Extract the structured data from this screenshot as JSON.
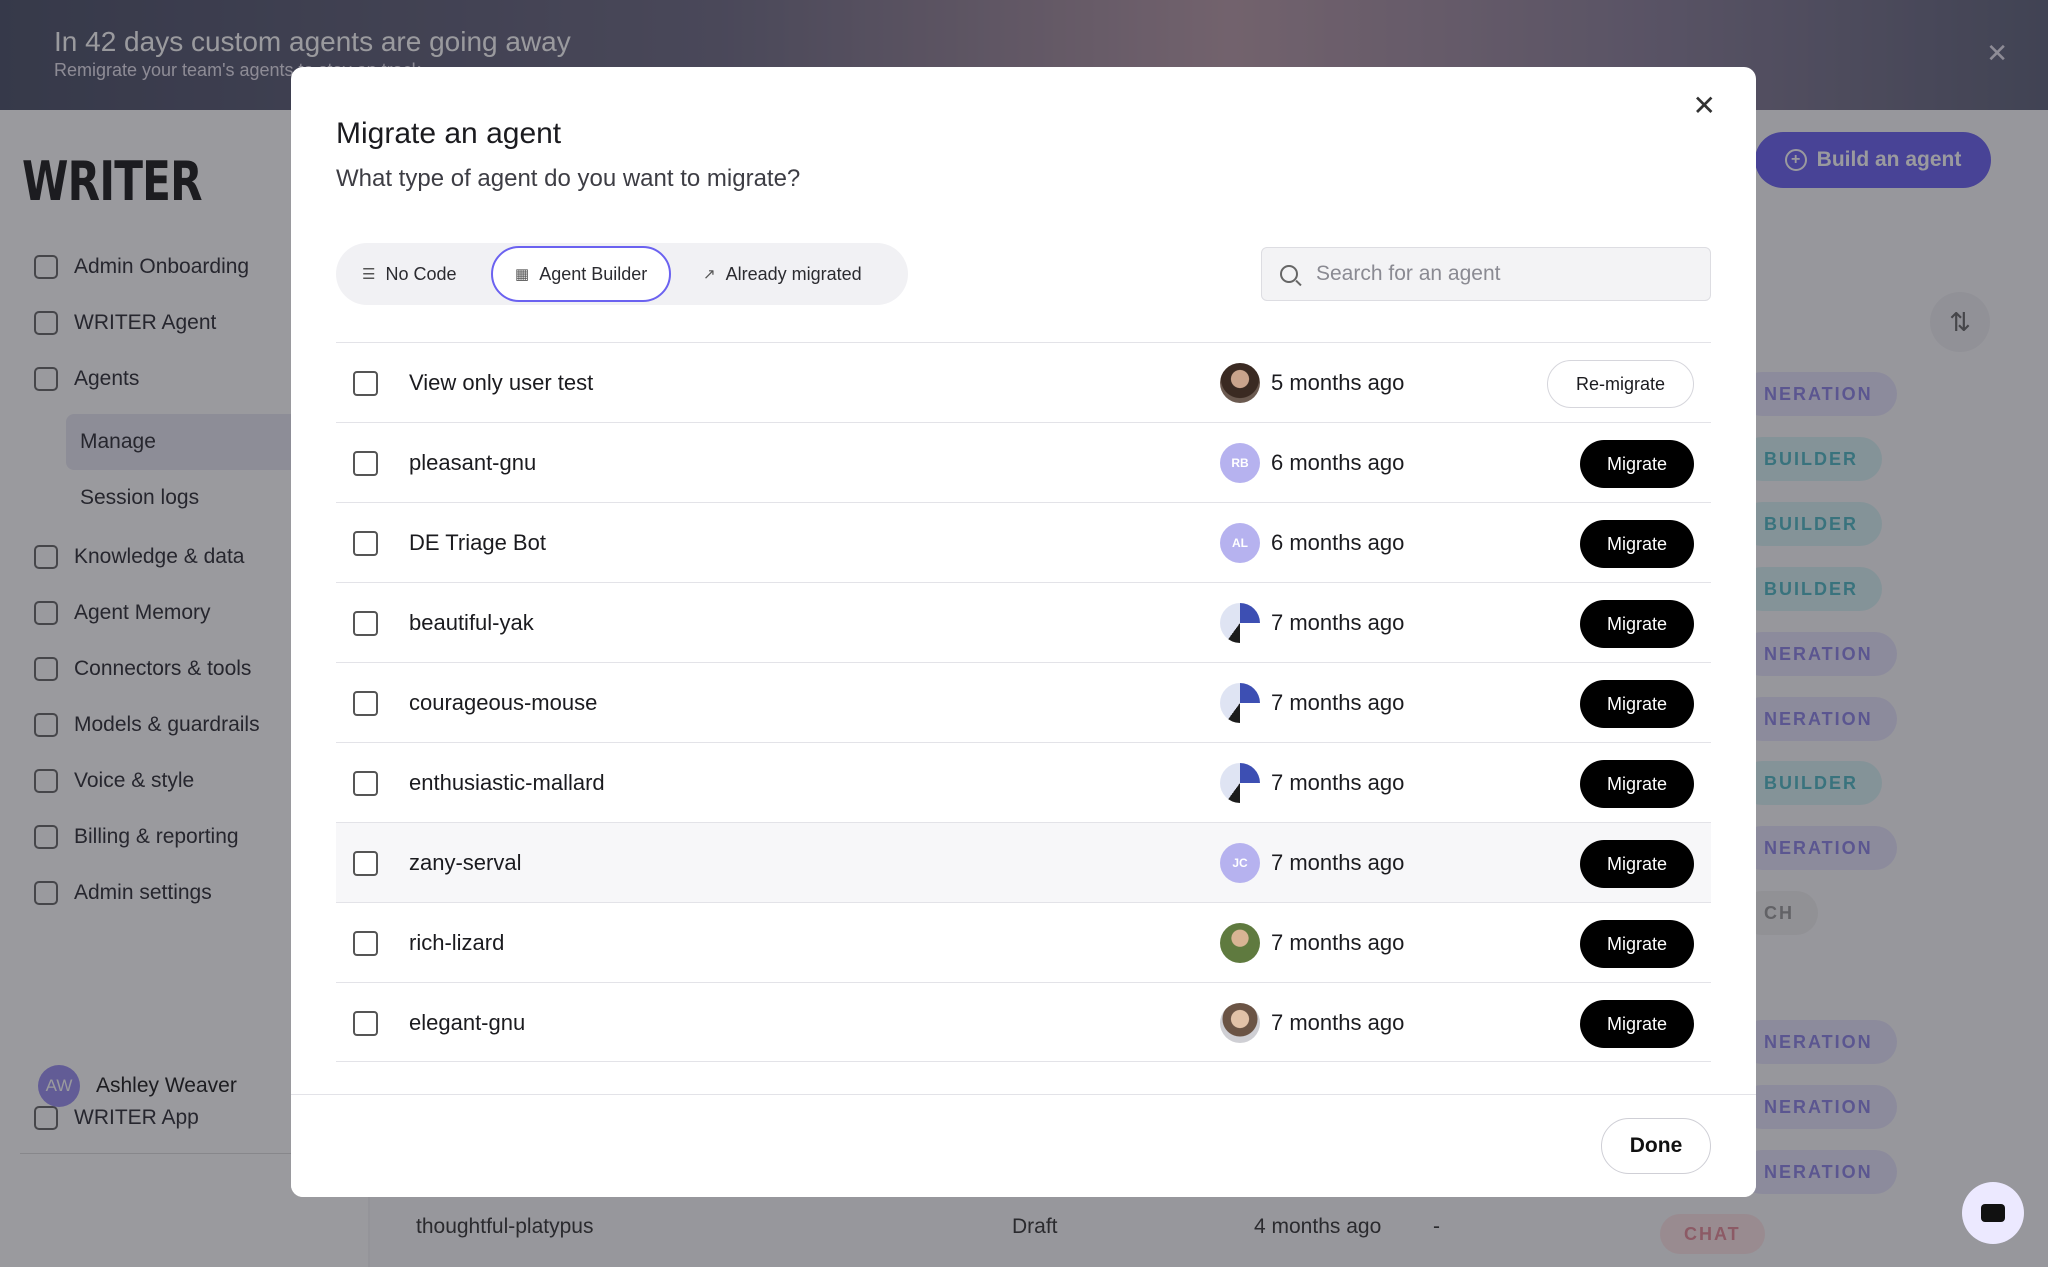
{
  "banner": {
    "title": "In 42 days custom agents are going away",
    "subtitle": "Remigrate your team's agents to stay on track",
    "close": "✕"
  },
  "sidebar": {
    "logo": "WRITER",
    "items": [
      {
        "label": "Admin Onboarding",
        "icon": "clipboard-icon"
      },
      {
        "label": "WRITER Agent",
        "icon": "writer-logo-icon"
      },
      {
        "label": "Agents",
        "icon": "agent-icon"
      },
      {
        "label": "Knowledge & data",
        "icon": "knowledge-icon"
      },
      {
        "label": "Agent Memory",
        "icon": "brain-icon"
      },
      {
        "label": "Connectors & tools",
        "icon": "plug-icon"
      },
      {
        "label": "Models & guardrails",
        "icon": "chip-icon"
      },
      {
        "label": "Voice & style",
        "icon": "palette-icon"
      },
      {
        "label": "Billing & reporting",
        "icon": "chart-icon"
      },
      {
        "label": "Admin settings",
        "icon": "sliders-icon"
      }
    ],
    "subitems": [
      {
        "label": "Manage",
        "active": true
      },
      {
        "label": "Session logs",
        "active": false
      }
    ],
    "writer_app": "WRITER App",
    "user": {
      "initials": "AW",
      "name": "Ashley Weaver"
    }
  },
  "main": {
    "build_button": "Build an agent",
    "tags": [
      "NERATION",
      "BUILDER",
      "BUILDER",
      "BUILDER",
      "NERATION",
      "NERATION",
      "BUILDER",
      "NERATION",
      "CH",
      "NERATION",
      "NERATION",
      "NERATION"
    ],
    "bottom_row": {
      "name": "thoughtful-platypus",
      "status": "Draft",
      "date": "4 months ago",
      "dash": "-",
      "tag": "CHAT"
    }
  },
  "modal": {
    "title": "Migrate an agent",
    "subtitle": "What type of agent do you want to migrate?",
    "close": "✕",
    "tabs": [
      {
        "label": "No Code",
        "icon": "list-icon"
      },
      {
        "label": "Agent Builder",
        "icon": "blocks-icon",
        "active": true
      },
      {
        "label": "Already migrated",
        "icon": "arrow-up-right-icon"
      }
    ],
    "search_placeholder": "Search for an agent",
    "rows": [
      {
        "name": "View only user test",
        "date": "5 months ago",
        "action": "Re-migrate",
        "avatar": ""
      },
      {
        "name": "pleasant-gnu",
        "date": "6 months ago",
        "action": "Migrate",
        "avatar": "RB"
      },
      {
        "name": "DE Triage Bot",
        "date": "6 months ago",
        "action": "Migrate",
        "avatar": "AL"
      },
      {
        "name": "beautiful-yak",
        "date": "7 months ago",
        "action": "Migrate",
        "avatar": ""
      },
      {
        "name": "courageous-mouse",
        "date": "7 months ago",
        "action": "Migrate",
        "avatar": ""
      },
      {
        "name": "enthusiastic-mallard",
        "date": "7 months ago",
        "action": "Migrate",
        "avatar": ""
      },
      {
        "name": "zany-serval",
        "date": "7 months ago",
        "action": "Migrate",
        "avatar": "JC"
      },
      {
        "name": "rich-lizard",
        "date": "7 months ago",
        "action": "Migrate",
        "avatar": ""
      },
      {
        "name": "elegant-gnu",
        "date": "7 months ago",
        "action": "Migrate",
        "avatar": ""
      }
    ],
    "done": "Done"
  },
  "colors": {
    "accent": "#6b62f0",
    "primary_button": "#000000"
  }
}
